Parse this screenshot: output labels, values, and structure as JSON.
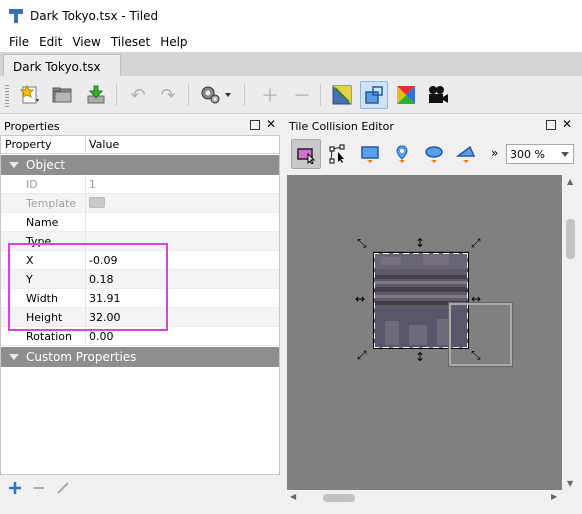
{
  "window": {
    "title": "Dark Tokyo.tsx - Tiled"
  },
  "menu": [
    "File",
    "Edit",
    "View",
    "Tileset",
    "Help"
  ],
  "tab": {
    "label": "Dark Tokyo.tsx"
  },
  "properties_panel": {
    "title": "Properties",
    "columns": [
      "Property",
      "Value"
    ],
    "groups": {
      "object": "Object",
      "custom": "Custom Properties"
    },
    "rows": [
      {
        "key": "ID",
        "value": "1"
      },
      {
        "key": "Template",
        "value": ""
      },
      {
        "key": "Name",
        "value": ""
      },
      {
        "key": "Type",
        "value": ""
      },
      {
        "key": "X",
        "value": "-0.09"
      },
      {
        "key": "Y",
        "value": "0.18"
      },
      {
        "key": "Width",
        "value": "31.91"
      },
      {
        "key": "Height",
        "value": "32.00"
      },
      {
        "key": "Rotation",
        "value": "0.00"
      }
    ]
  },
  "collision_panel": {
    "title": "Tile Collision Editor",
    "zoom": "300 %",
    "overflow": "»"
  },
  "colors": {
    "highlight": "#e040e0",
    "group_header": "#8e8e8e",
    "canvas_bg": "#808080"
  }
}
